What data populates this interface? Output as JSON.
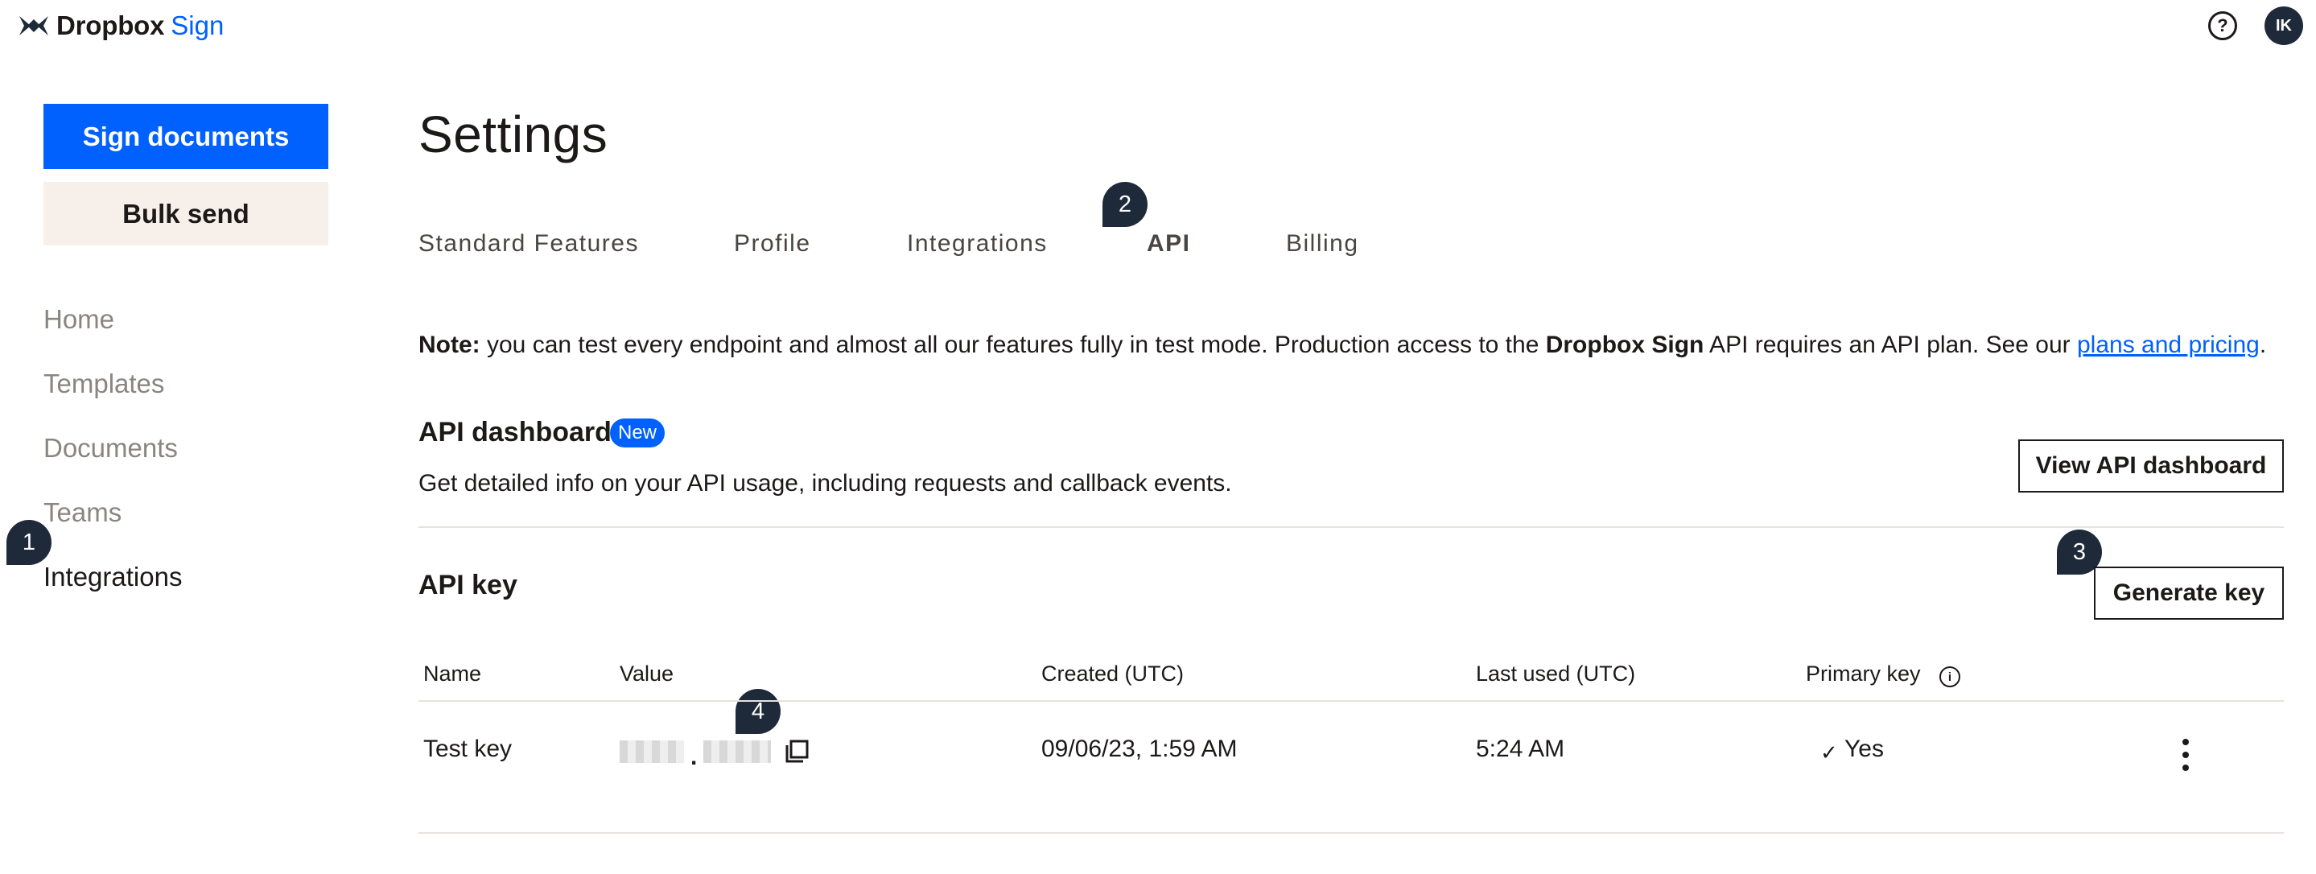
{
  "brand": {
    "name": "Dropbox",
    "product": "Sign"
  },
  "topbar": {
    "help_icon": "question-circle-icon",
    "help_glyph": "?",
    "avatar_initials": "IK"
  },
  "sidebar": {
    "primary_button": "Sign documents",
    "secondary_button": "Bulk send",
    "items": [
      {
        "label": "Home"
      },
      {
        "label": "Templates"
      },
      {
        "label": "Documents"
      },
      {
        "label": "Teams"
      },
      {
        "label": "Integrations",
        "active": true
      }
    ]
  },
  "markers": [
    "1",
    "2",
    "3",
    "4"
  ],
  "main": {
    "title": "Settings",
    "tabs": [
      {
        "label": "Standard Features"
      },
      {
        "label": "Profile"
      },
      {
        "label": "Integrations"
      },
      {
        "label": "API",
        "active": true
      },
      {
        "label": "Billing"
      }
    ],
    "note": {
      "prefix": "Note:",
      "text1": " you can test every endpoint and almost all our features fully in test mode. Production access to the ",
      "bold": "Dropbox Sign",
      "text2": " API requires an API plan. See our ",
      "link": "plans and pricing",
      "suffix": "."
    },
    "dashboard": {
      "title": "API dashboard",
      "badge": "New",
      "description": "Get detailed info on your API usage, including requests and callback events.",
      "button": "View API dashboard"
    },
    "api_key": {
      "title": "API key",
      "button": "Generate key",
      "columns": [
        "Name",
        "Value",
        "Created (UTC)",
        "Last used (UTC)",
        "Primary key"
      ],
      "rows": [
        {
          "name": "Test key",
          "value_separator": ".",
          "created": "09/06/23, 1:59 AM",
          "last_used": "5:24 AM",
          "primary": "Yes"
        }
      ]
    }
  },
  "colors": {
    "accent": "#0061fe",
    "marker": "#1e2a3a",
    "bulk_bg": "#f7f0ea"
  }
}
